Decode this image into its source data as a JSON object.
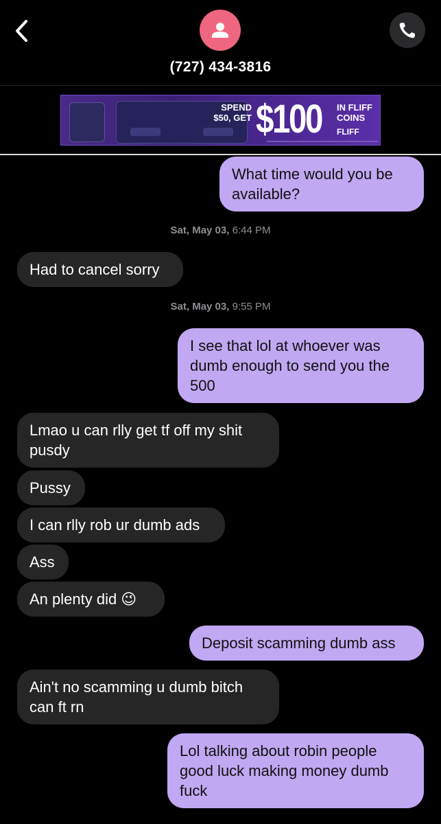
{
  "header": {
    "contact_phone": "(727) 434-3816",
    "avatar_color": "#ef6680",
    "call_button_color": "#2a2a2c"
  },
  "ad": {
    "spend_line1": "SPEND",
    "spend_line2": "$50, GET",
    "amount": "$100",
    "coins_line1": "IN FLIFF",
    "coins_line2": "COINS",
    "brand": "FLIFF"
  },
  "messages": [
    {
      "type": "outgoing",
      "text": "What time would you be available?"
    },
    {
      "type": "timestamp",
      "date": "Sat, May 03,",
      "time": "6:44 PM"
    },
    {
      "type": "incoming",
      "text": "Had to cancel sorry"
    },
    {
      "type": "timestamp",
      "date": "Sat, May 03,",
      "time": "9:55 PM"
    },
    {
      "type": "outgoing",
      "text": "I see that lol at whoever was dumb enough to send you the 500"
    },
    {
      "type": "incoming",
      "text": "Lmao u can rlly get tf off my shit pusdy"
    },
    {
      "type": "incoming",
      "text": "Pussy"
    },
    {
      "type": "incoming",
      "text": "I can rlly rob ur dumb ads"
    },
    {
      "type": "incoming",
      "text": "Ass"
    },
    {
      "type": "incoming",
      "text": "An plenty did 😉"
    },
    {
      "type": "outgoing",
      "text": "Deposit scamming dumb ass"
    },
    {
      "type": "incoming",
      "text": "Ain't no scamming u dumb bitch can ft rn"
    },
    {
      "type": "outgoing",
      "text": "Lol talking about robin people good luck making money dumb fuck"
    }
  ],
  "colors": {
    "outgoing_bubble": "#c0a8f2",
    "incoming_bubble": "#262626",
    "background": "#000000"
  }
}
